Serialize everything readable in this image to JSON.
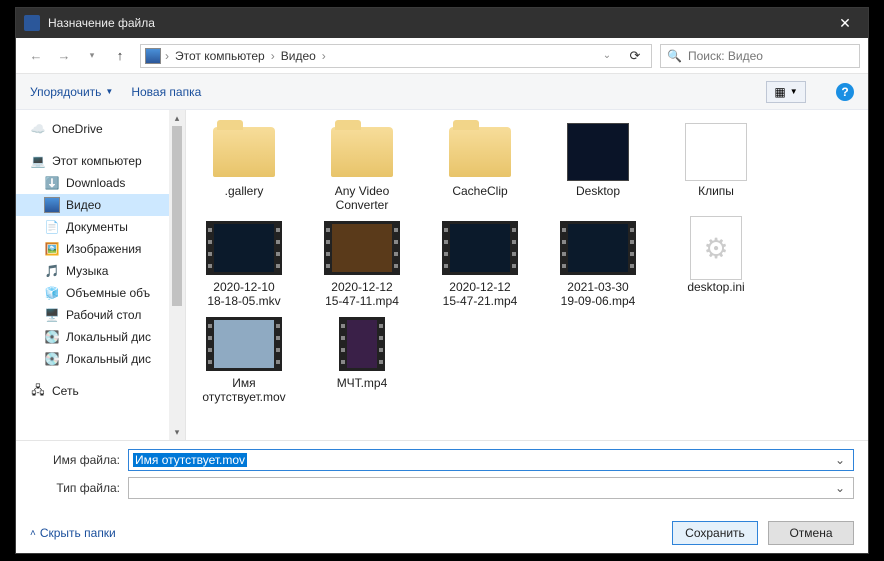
{
  "title": "Назначение файла",
  "breadcrumb": {
    "root": "Этот компьютер",
    "folder": "Видео"
  },
  "search": {
    "placeholder": "Поиск: Видео"
  },
  "toolbar": {
    "organize": "Упорядочить",
    "newfolder": "Новая папка"
  },
  "sidebar": {
    "onedrive": "OneDrive",
    "thispc": "Этот компьютер",
    "downloads": "Downloads",
    "video": "Видео",
    "documents": "Документы",
    "images": "Изображения",
    "music": "Музыка",
    "volumes": "Объемные объ",
    "desktop": "Рабочий стол",
    "local1": "Локальный дис",
    "local2": "Локальный дис",
    "network": "Сеть"
  },
  "files": {
    "f0": ".gallery",
    "f1": "Any Video Converter",
    "f2": "CacheClip",
    "f3": "Desktop",
    "f4": "Клипы",
    "f5a": "2020-12-10",
    "f5b": "18-18-05.mkv",
    "f6a": "2020-12-12",
    "f6b": "15-47-11.mp4",
    "f7a": "2020-12-12",
    "f7b": "15-47-21.mp4",
    "f8a": "2021-03-30",
    "f8b": "19-09-06.mp4",
    "f9": "desktop.ini",
    "f10a": "Имя",
    "f10b": "отутствует.mov",
    "f11": "МЧТ.mp4"
  },
  "bottom": {
    "fname_label": "Имя файла:",
    "fname_value": "Имя отутствует.mov",
    "ftype_label": "Тип файла:"
  },
  "footer": {
    "hide": "Скрыть папки",
    "save": "Сохранить",
    "cancel": "Отмена"
  }
}
